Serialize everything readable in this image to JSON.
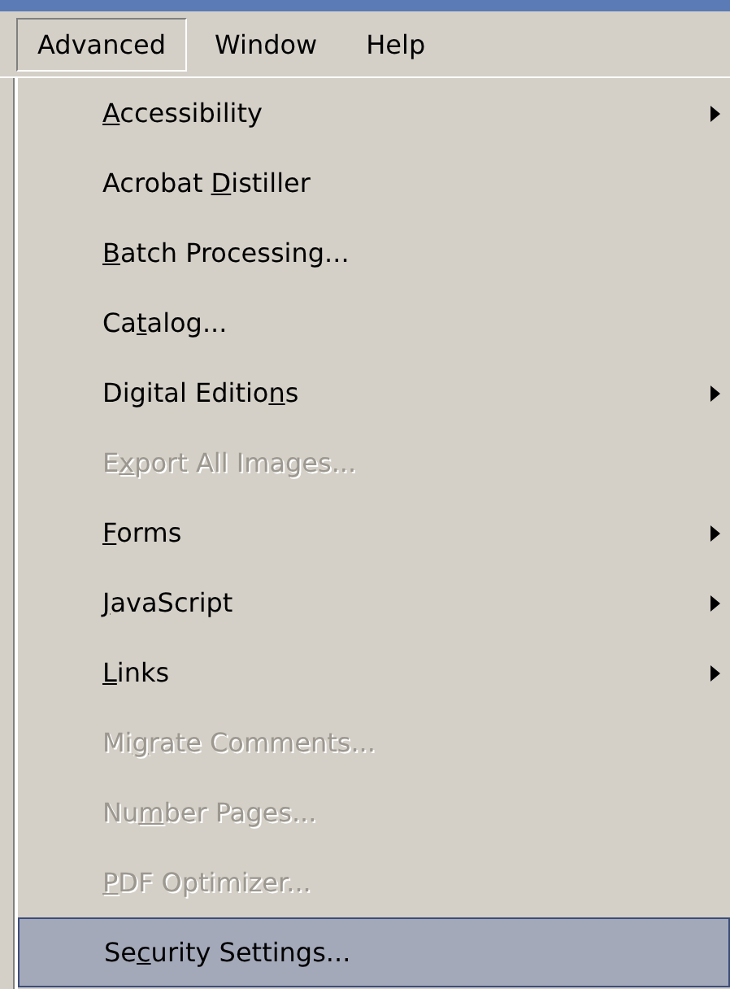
{
  "menu_bar": [
    {
      "label": "Advanced",
      "selected": true
    },
    {
      "label": "Window",
      "selected": false
    },
    {
      "label": "Help",
      "selected": false
    }
  ],
  "menu": {
    "items": [
      {
        "access_key": "A",
        "after": "ccessibility",
        "disabled": false,
        "submenu": true,
        "selected": false
      },
      {
        "before": "Acrobat ",
        "access_key": "D",
        "after": "istiller",
        "disabled": false,
        "submenu": false,
        "selected": false
      },
      {
        "access_key": "B",
        "after": "atch Processing...",
        "disabled": false,
        "submenu": false,
        "selected": false
      },
      {
        "before": "Ca",
        "access_key": "t",
        "after": "alog...",
        "disabled": false,
        "submenu": false,
        "selected": false
      },
      {
        "before": "Digital Editio",
        "access_key": "n",
        "after": "s",
        "disabled": false,
        "submenu": true,
        "selected": false
      },
      {
        "before": "E",
        "access_key": "x",
        "after": "port All Images...",
        "disabled": true,
        "submenu": false,
        "selected": false
      },
      {
        "access_key": "F",
        "after": "orms",
        "disabled": false,
        "submenu": true,
        "selected": false
      },
      {
        "access_key": "J",
        "after": "avaScript",
        "disabled": false,
        "submenu": true,
        "selected": false
      },
      {
        "access_key": "L",
        "after": "inks",
        "disabled": false,
        "submenu": true,
        "selected": false
      },
      {
        "before": "Mi",
        "access_key": "g",
        "after": "rate Comments...",
        "disabled": true,
        "submenu": false,
        "selected": false
      },
      {
        "before": "Nu",
        "access_key": "m",
        "after": "ber Pages...",
        "disabled": true,
        "submenu": false,
        "selected": false
      },
      {
        "access_key": "P",
        "after": "DF Optimizer...",
        "disabled": true,
        "submenu": false,
        "selected": false
      },
      {
        "before": "Se",
        "access_key": "c",
        "after": "urity Settings...",
        "disabled": false,
        "submenu": false,
        "selected": true
      }
    ]
  }
}
